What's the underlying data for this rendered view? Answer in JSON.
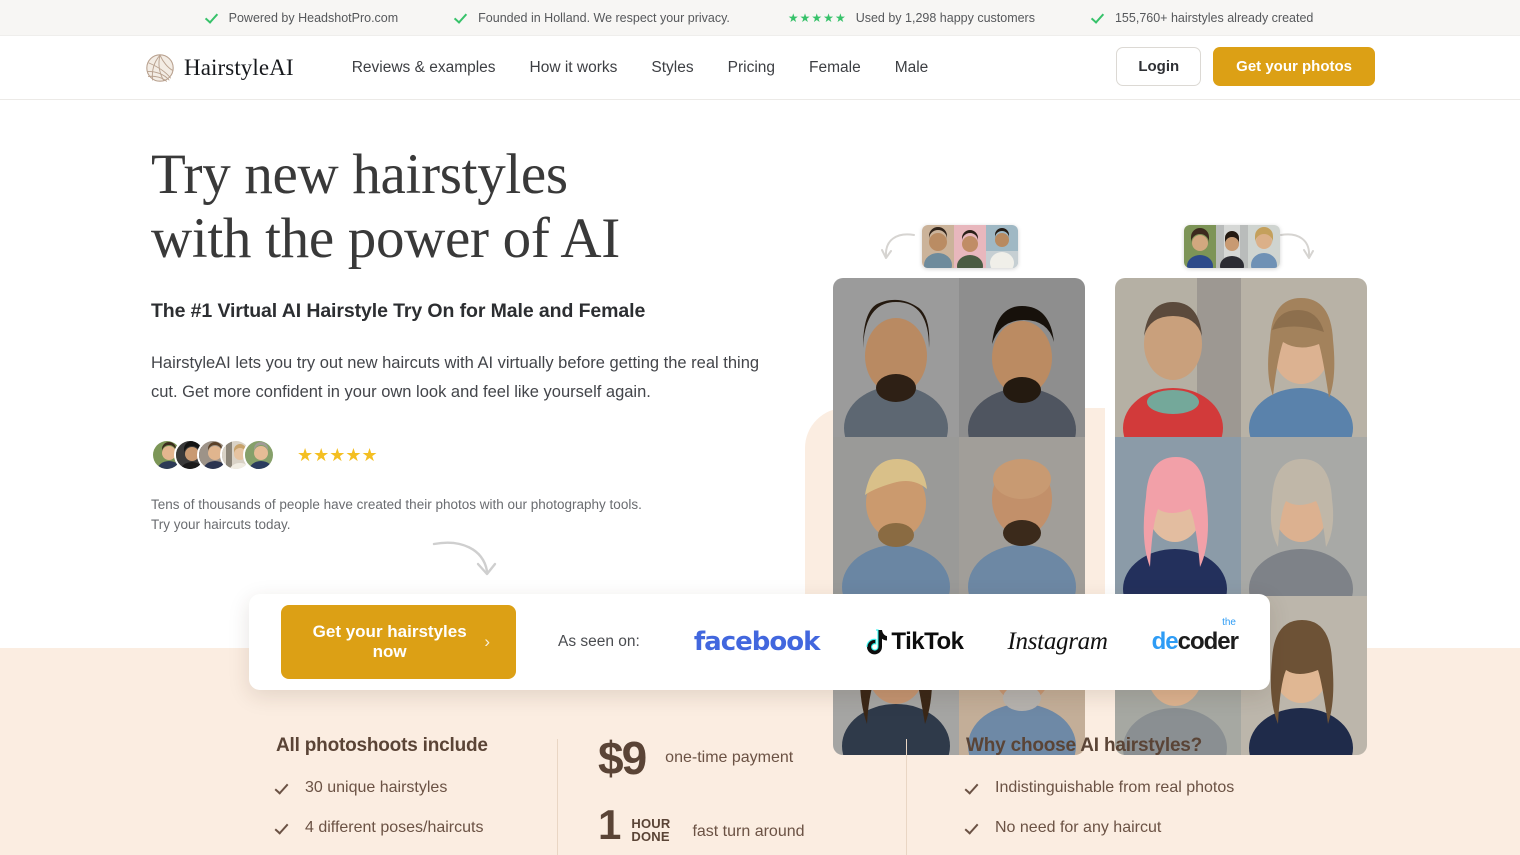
{
  "topbar": {
    "items": [
      {
        "icon": "check-icon",
        "text": "Powered by HeadshotPro.com"
      },
      {
        "icon": "check-icon",
        "text": "Founded in Holland. We respect your privacy."
      },
      {
        "icon": "stars-icon",
        "text": "Used by 1,298 happy customers"
      },
      {
        "icon": "check-icon",
        "text": "155,760+ hairstyles already created"
      }
    ]
  },
  "header": {
    "brand": "HairstyleAI",
    "nav": [
      {
        "label": "Reviews & examples"
      },
      {
        "label": "How it works"
      },
      {
        "label": "Styles"
      },
      {
        "label": "Pricing"
      },
      {
        "label": "Female"
      },
      {
        "label": "Male"
      }
    ],
    "login_label": "Login",
    "cta_label": "Get your photos"
  },
  "hero": {
    "heading_line1": "Try new hairstyles",
    "heading_line2": "with the power of AI",
    "subheading": "The #1 Virtual AI Hairstyle Try On for Male and Female",
    "paragraph": "HairstyleAI lets you try out new haircuts with AI virtually before getting the real thing cut. Get more confident in your own look and feel like yourself again.",
    "rating_stars": "★★★★★",
    "note": "Tens of thousands of people have created their photos with our photography tools. Try your haircuts today."
  },
  "cta": {
    "button_label": "Get your hairstyles now",
    "chevron": "›",
    "as_seen_on": "As seen on:",
    "logos": [
      {
        "name": "facebook-logo",
        "text": "facebook"
      },
      {
        "name": "tiktok-logo",
        "text": "TikTok"
      },
      {
        "name": "instagram-logo",
        "text": "Instagram"
      },
      {
        "name": "decoder-logo",
        "text_de": "de",
        "text_coder": "coder",
        "text_the": "the"
      }
    ]
  },
  "features": {
    "col1": {
      "title": "All photoshoots include",
      "items": [
        "30 unique hairstyles",
        "4 different poses/haircuts"
      ]
    },
    "col2": {
      "price": "$9",
      "price_label": "one-time payment",
      "hour_number": "1",
      "hour_line1": "HOUR",
      "hour_line2": "DONE",
      "hour_label": "fast turn around"
    },
    "col3": {
      "title": "Why choose AI hairstyles?",
      "items": [
        "Indistinguishable from real photos",
        "No need for any haircut"
      ]
    }
  },
  "colors": {
    "gold": "#dca015",
    "cream": "#fbede1",
    "green": "#37c26a",
    "star_gold": "#f4bf22",
    "brown_text": "#6b5244"
  }
}
